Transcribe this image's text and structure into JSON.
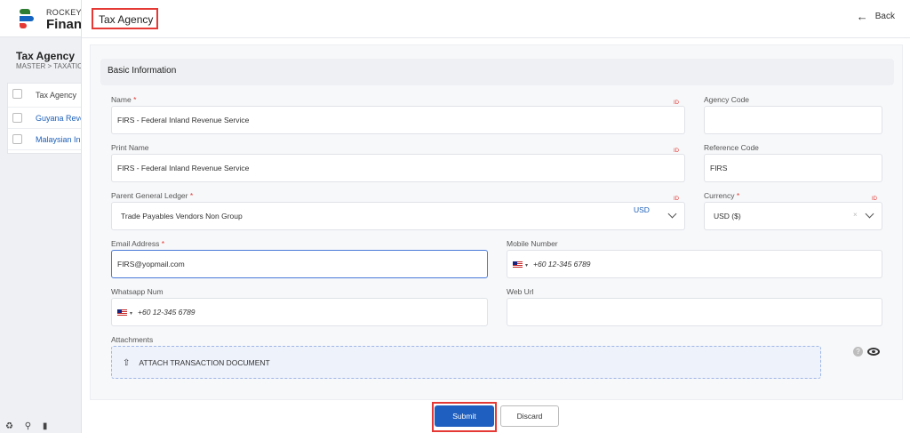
{
  "background": {
    "brand_small": "ROCKEYE",
    "brand_big": "Financ",
    "page_title": "Tax Agency",
    "breadcrumb": "MASTER  >  TAXATIC",
    "table_header": "Tax Agency",
    "table_sort_icon": "sort-icon",
    "rows": [
      "Guyana Reve",
      "Malaysian Inl"
    ],
    "bottom_icons": [
      "recycle-icon",
      "link-icon",
      "bookmark-icon"
    ]
  },
  "drawer": {
    "title": "Tax Agency",
    "back_label": "Back",
    "section_title": "Basic Information",
    "fields": {
      "name": {
        "label": "Name",
        "value": "FIRS - Federal Inland Revenue Service"
      },
      "agency_code": {
        "label": "Agency Code",
        "value": ""
      },
      "print_name": {
        "label": "Print Name",
        "value": "FIRS - Federal Inland Revenue Service"
      },
      "reference_code": {
        "label": "Reference Code",
        "value": "FIRS"
      },
      "parent_gl": {
        "label": "Parent General Ledger",
        "value": "Trade Payables Vendors Non Group",
        "tag": "USD"
      },
      "currency": {
        "label": "Currency",
        "value": "USD ($)"
      },
      "email": {
        "label": "Email Address",
        "value": "FIRS@yopmail.com"
      },
      "mobile": {
        "label": "Mobile Number",
        "value": "+60 12-345 6789"
      },
      "whatsapp": {
        "label": "Whatsapp Num",
        "value": "+60 12-345 6789"
      },
      "web_url": {
        "label": "Web Url",
        "value": ""
      },
      "attachments": {
        "label": "Attachments",
        "button": "ATTACH TRANSACTION DOCUMENT"
      }
    },
    "required_mark": "*",
    "lang_marker": "ID",
    "submit_label": "Submit",
    "discard_label": "Discard"
  },
  "colors": {
    "primary": "#1f5fbf",
    "highlight": "#e53935"
  }
}
